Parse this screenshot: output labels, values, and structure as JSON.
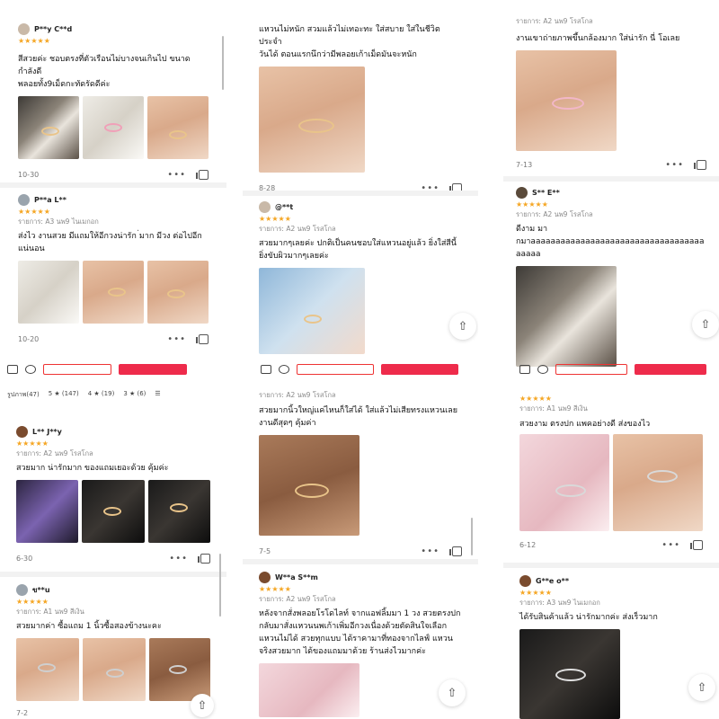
{
  "colors": {
    "star": "#f5a623",
    "accent": "#ee2b4b"
  },
  "panels": {
    "p1": {
      "reviews": [
        {
          "user": "P**y C**d",
          "stars": "★★★★★",
          "text": "สีสวยค่ะ ชอบตรงที่ตัวเรือนไม่บางจนเกินไป ขนาดกำลังดี\nพลอยทั้ง9เม็ดกะทัดรัดดีค่ะ",
          "date": "10-30"
        },
        {
          "user": "P**a L**",
          "stars": "★★★★★",
          "variant": "รายการ: A3 นพ9 ไนเมกอก",
          "text": "ส่งไว งานสวย มีแถมให้อีกวงน่ารัก ่มาก มีวง ต่อไปอีก\nแน่นอน",
          "date": "10-20"
        }
      ]
    },
    "p2": {
      "top_text": "แหวนไม่หนัก สวมแล้วไม่เทอะทะ ใส่สบาย ใส่ในชีวิตประจำ\nวันได้ ตอนแรกนึกว่ามีพลอยเก้าเม็ดมันจะหนัก",
      "date1": "8-28",
      "review": {
        "user": "@**t",
        "stars": "★★★★★",
        "variant": "รายการ: A2 นพ9 โรสโกล",
        "text": "สวยมากๆเลยค่ะ ปกติเป็นคนชอบใส่แหวนอยู่แล้ว ยิ่งใส่สีนี้\nยิ่งขับผิวมากๆเลยค่ะ"
      }
    },
    "p3": {
      "top_variant": "รายการ: A2 นพ9 โรสโกล",
      "top_text": "งานเขาถ่ายภาพขึ้นกล้องมาก ใส่น่ารัก นี่ โอเลย",
      "date1": "7-13",
      "review": {
        "user": "S** E**",
        "stars": "★★★★★",
        "variant": "รายการ: A2 นพ9 โรสโกล",
        "text": "ดีงาม มา\nกมาaaaaaaaaaaaaaaaaaaaaaaaaaaaaaaaaaaaaaaaa"
      }
    },
    "p4": {
      "filters": [
        "รูปภาพ(47)",
        "5 ★ (147)",
        "4 ★ (19)",
        "3 ★ (6)"
      ],
      "reviews": [
        {
          "user": "L** J**y",
          "stars": "★★★★★",
          "variant": "รายการ: A2 นพ9 โรสโกล",
          "text": "สวยมาก น่ารักมาก ของแถมเยอะด้วย คุ้มค่ะ",
          "date": "6-30"
        },
        {
          "user": "ข**u",
          "stars": "★★★★★",
          "variant": "รายการ: A1 นพ9 สีเงิน",
          "text": "สวยมากค่า ซื้อแถม 1 นิ้วซื้อสองข้างนะคะ",
          "date": "7-2"
        }
      ]
    },
    "p5": {
      "top_variant": "รายการ: A2 นพ9 โรสโกล",
      "top_text": "สวยมากนิ้วใหญ่แค่ไหนก็ใส่ได้ ใส่แล้วไม่เสียทรงแหวนเลย\nงานดีสุดๆ คุ้มค่า",
      "date1": "7-5",
      "review": {
        "user": "W**a S**m",
        "stars": "★★★★★",
        "variant": "รายการ: A2 นพ9 โรสโกล",
        "text": "หลังจากสั่งพลอยโรโดไลท์ จากแอฟลิ้มมา 1 วง สวยตรงปก\nกลับมาสั่งแหวนนพเก้าเพิ่มอีกวงเนื่องด้วยตัดสินใจเลือก\nแหวนไม่ได้ สวยทุกแบบ ได้ราคามาที่ทองจากไลฟ์  แหวน\nจริงสวยมาก  ได้ของแถมมาด้วย  ร้านส่งไวมากค่ะ"
      }
    },
    "p6": {
      "review1": {
        "stars": "★★★★★",
        "variant": "รายการ: A1 นพ9 สีเงิน",
        "text": "สวยงาม ตรงปก แพคอย่างดี ส่งของไว",
        "date": "6-12"
      },
      "review2": {
        "user": "G**e o**",
        "stars": "★★★★★",
        "variant": "รายการ: A3 นพ9 ไนเมกอก",
        "text": "ได้รับสินค้าแล้ว น่ารักมากค่ะ ส่งเร็วมาก"
      }
    }
  }
}
